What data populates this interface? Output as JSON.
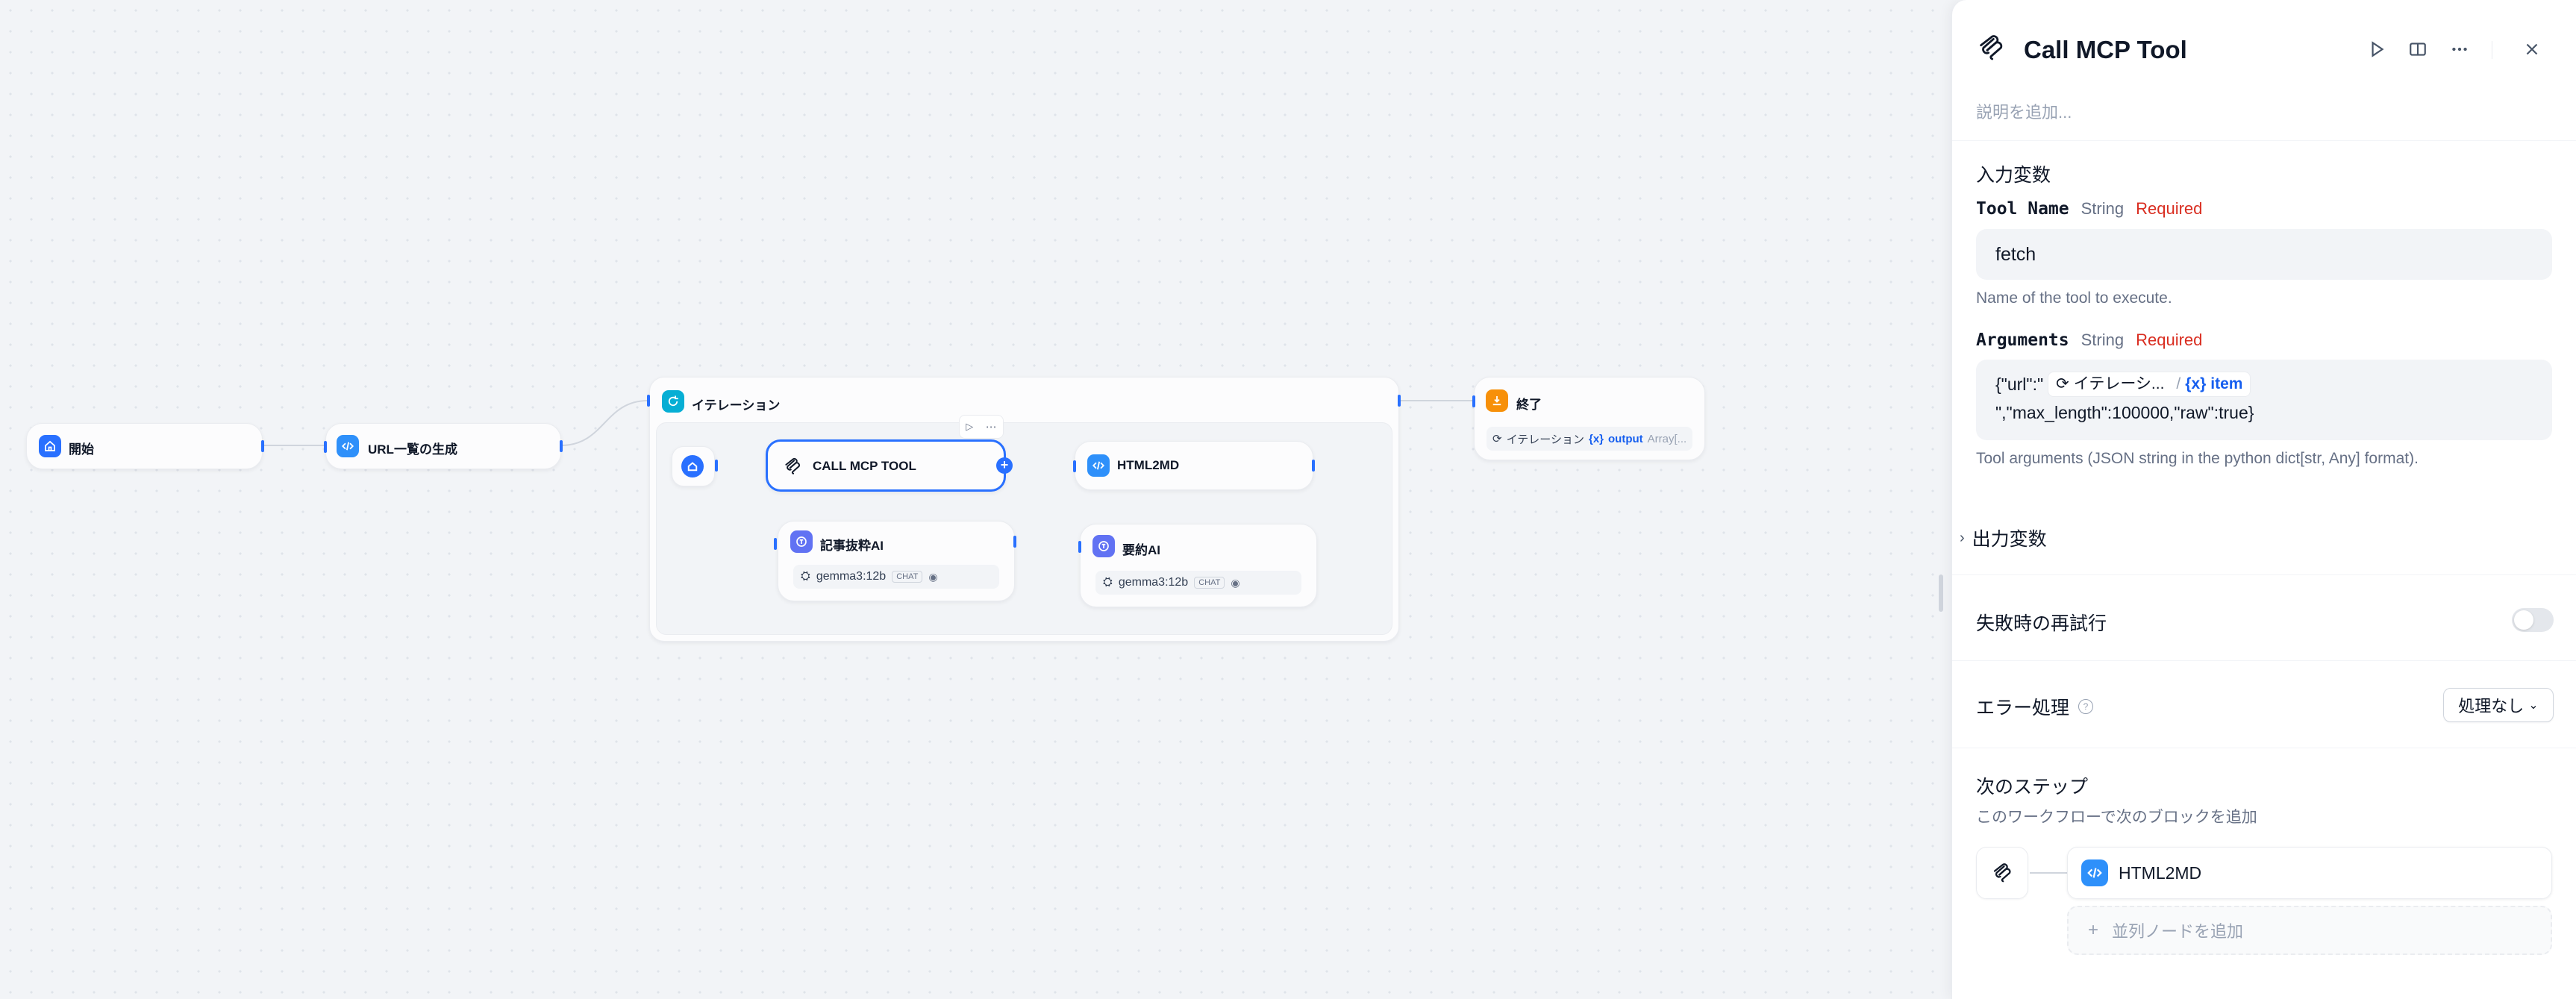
{
  "canvas": {
    "nodes": {
      "start": {
        "title": "開始"
      },
      "url_gen": {
        "title": "URL一覧の生成"
      },
      "iteration": {
        "title": "イテレーション"
      },
      "call_mcp": {
        "title": "CALL MCP TOOL"
      },
      "html2md": {
        "title": "HTML2MD"
      },
      "extract_ai": {
        "title": "記事抜粋AI",
        "model": "gemma3:12b",
        "mode": "CHAT"
      },
      "summary_ai": {
        "title": "要約AI",
        "model": "gemma3:12b",
        "mode": "CHAT"
      },
      "end": {
        "title": "終了",
        "var_source": "イテレーション",
        "var_name": "output",
        "var_type": "Array[..."
      }
    }
  },
  "panel": {
    "title": "Call MCP Tool",
    "description_placeholder": "説明を追加...",
    "input_section": "入力変数",
    "tool_name": {
      "label": "Tool Name",
      "type": "String",
      "required": "Required",
      "value": "fetch",
      "desc": "Name of the tool to execute."
    },
    "arguments": {
      "label": "Arguments",
      "type": "String",
      "required": "Required",
      "prefix": "{\"url\":\"",
      "var_node": "イテレーシ...",
      "var_sep": "/",
      "var_name": "item",
      "line2": "\",\"max_length\":100000,\"raw\":true}",
      "desc": "Tool arguments (JSON string in the python dict[str, Any] format)."
    },
    "output_section": "出力変数",
    "retry": {
      "label": "失敗時の再試行"
    },
    "error_handling": {
      "label": "エラー処理",
      "value": "処理なし"
    },
    "next_step": {
      "title": "次のステップ",
      "desc": "このワークフローで次のブロックを追加",
      "node": "HTML2MD",
      "add_parallel": "並列ノードを追加"
    }
  },
  "colors": {
    "accent": "#2970ff",
    "code_block": "#2e90fa",
    "llm_block": "#6172f3",
    "iteration_block": "#06aed4",
    "end_block": "#f79009",
    "required": "#d92d20"
  }
}
